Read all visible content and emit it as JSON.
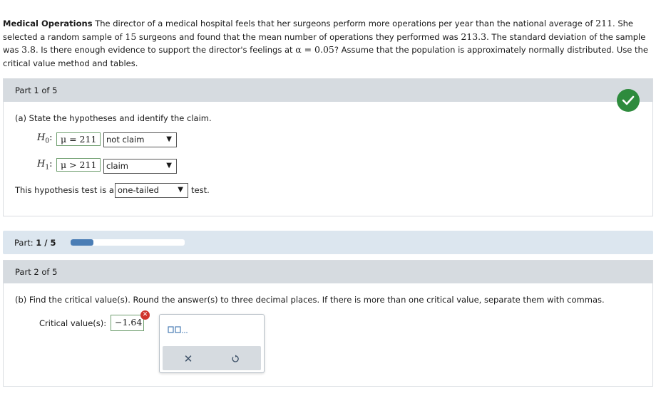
{
  "problem": {
    "title": "Medical Operations",
    "text_1": " The director of a medical hospital feels that her surgeons perform more operations per year than the national average of ",
    "avg": "211",
    "text_2": ". She selected a random sample of ",
    "n": "15",
    "text_3": " surgeons and found that the mean number of operations they performed was ",
    "mean": "213.3",
    "text_4": ". The standard deviation of the sample was ",
    "sd": "3.8",
    "text_5": ". Is there enough evidence to support the director's feelings at ",
    "alpha": "α = 0.05",
    "text_6": "? Assume that the population is approximately normally distributed. Use the critical value method and tables."
  },
  "part1": {
    "header": "Part 1 of 5",
    "question": "(a) State the hypotheses and identify the claim.",
    "h0": {
      "letter": "H",
      "sub": "0",
      "colon": ":",
      "expr": "μ = 211",
      "claim": "not claim"
    },
    "h1": {
      "letter": "H",
      "sub": "1",
      "colon": ":",
      "expr": "μ > 211",
      "claim": "claim"
    },
    "test_prefix": "This hypothesis test is a",
    "test_value": "one-tailed",
    "test_suffix": "test.",
    "status": "correct",
    "check_icon": "checkmark-icon",
    "check_color": "#2e8b3d"
  },
  "progress": {
    "label": "Part:",
    "value": "1 / 5",
    "fraction": 0.2,
    "color": "#4a7db5"
  },
  "part2": {
    "header": "Part 2 of 5",
    "question": "(b) Find the critical value(s). Round the answer(s) to three decimal places. If there is more than one critical value, separate them with commas.",
    "cv_label": "Critical value(s):",
    "cv_value": "−1.64",
    "error_icon": "error-x-icon",
    "error_color": "#d0342c",
    "palette": {
      "tool_icon": "list-entry-icon",
      "clear_icon": "clear-x-icon",
      "undo_icon": "undo-icon"
    }
  }
}
